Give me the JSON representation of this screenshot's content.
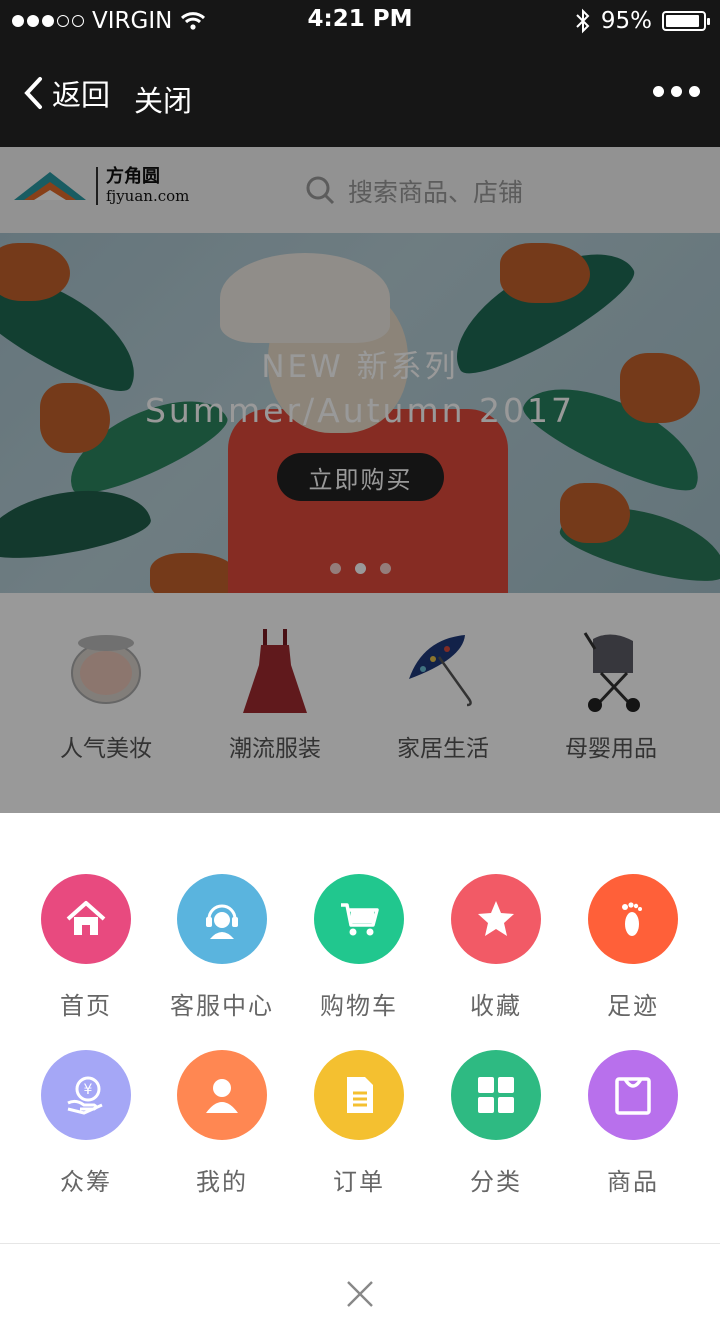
{
  "status_bar": {
    "carrier": "VIRGIN",
    "time": "4:21 PM",
    "battery": "95%",
    "battery_level": 0.95,
    "signal_bars": 3,
    "signal_max": 5
  },
  "nav": {
    "back_label": "返回",
    "close_label": "关闭",
    "icons": [
      "chevron-left-icon",
      "more-dots-icon"
    ]
  },
  "shop": {
    "logo_cn": "方角圆",
    "logo_en": "fjyuan.com",
    "search_placeholder": "搜索商品、店铺"
  },
  "banner": {
    "line1": "NEW 新系列",
    "line2": "Summer/Autumn 2017",
    "button": "立即购买",
    "slide_count": 3,
    "active_slide": 2
  },
  "categories": [
    {
      "label": "人气美妆",
      "icon": "compact-powder-icon"
    },
    {
      "label": "潮流服装",
      "icon": "dress-icon"
    },
    {
      "label": "家居生活",
      "icon": "umbrella-icon"
    },
    {
      "label": "母婴用品",
      "icon": "stroller-icon"
    }
  ],
  "menu": {
    "items": [
      {
        "label": "首页",
        "icon": "home-icon",
        "color": "#e84a7f"
      },
      {
        "label": "客服中心",
        "icon": "headset-icon",
        "color": "#5ab4de"
      },
      {
        "label": "购物车",
        "icon": "cart-icon",
        "color": "#21c78e"
      },
      {
        "label": "收藏",
        "icon": "star-icon",
        "color": "#f25a66"
      },
      {
        "label": "足迹",
        "icon": "footprint-icon",
        "color": "#ff6039"
      },
      {
        "label": "众筹",
        "icon": "crowdfund-icon",
        "color": "#a5a7f6"
      },
      {
        "label": "我的",
        "icon": "user-icon",
        "color": "#ff8752"
      },
      {
        "label": "订单",
        "icon": "order-icon",
        "color": "#f4c030"
      },
      {
        "label": "分类",
        "icon": "grid-icon",
        "color": "#2eba82"
      },
      {
        "label": "商品",
        "icon": "bag-icon",
        "color": "#b870ec"
      }
    ],
    "close_icon": "close-icon"
  }
}
